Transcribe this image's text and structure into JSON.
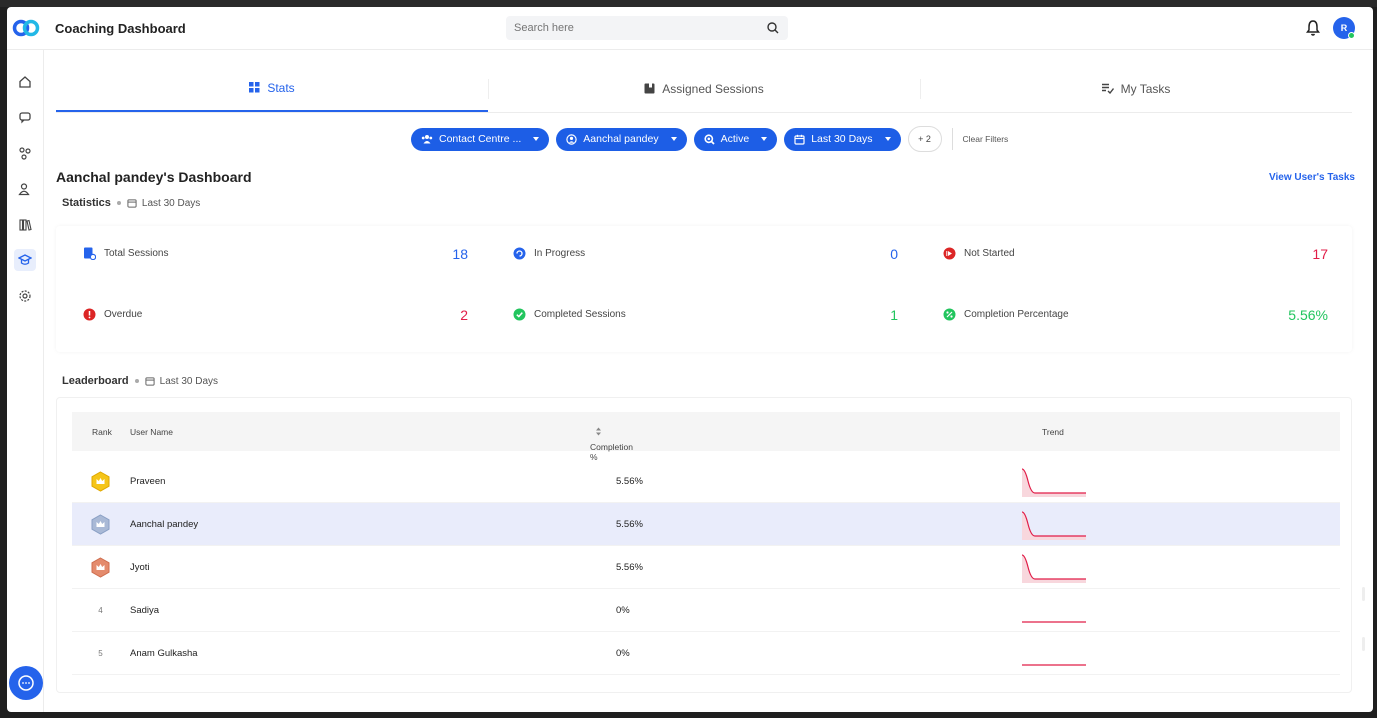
{
  "app": {
    "title": "Coaching Dashboard",
    "avatar_initial": "R"
  },
  "search": {
    "placeholder": "Search here"
  },
  "tabs": [
    {
      "label": "Stats",
      "icon": "grid-icon",
      "active": true
    },
    {
      "label": "Assigned Sessions",
      "icon": "book-icon",
      "active": false
    },
    {
      "label": "My Tasks",
      "icon": "tasks-icon",
      "active": false
    }
  ],
  "filters": {
    "chips": [
      {
        "label": "Contact Centre ...",
        "icon": "team-icon"
      },
      {
        "label": "Aanchal pandey",
        "icon": "user-circle-icon"
      },
      {
        "label": "Active",
        "icon": "search-status-icon"
      },
      {
        "label": "Last 30 Days",
        "icon": "calendar-icon"
      }
    ],
    "more": "+ 2",
    "clear": "Clear Filters"
  },
  "dashboard": {
    "title": "Aanchal pandey's Dashboard",
    "view_tasks": "View User's Tasks"
  },
  "statistics": {
    "label": "Statistics",
    "range": "Last 30 Days",
    "items": [
      {
        "label": "Total Sessions",
        "value": "18",
        "color": "#2563eb",
        "icon": "session-icon"
      },
      {
        "label": "In Progress",
        "value": "0",
        "color": "#2563eb",
        "icon": "progress-icon"
      },
      {
        "label": "Not Started",
        "value": "17",
        "color": "#e11d48",
        "icon": "not-started-icon"
      },
      {
        "label": "Overdue",
        "value": "2",
        "color": "#e11d48",
        "icon": "alert-icon"
      },
      {
        "label": "Completed Sessions",
        "value": "1",
        "color": "#22c55e",
        "icon": "check-icon"
      },
      {
        "label": "Completion Percentage",
        "value": "5.56%",
        "color": "#22c55e",
        "icon": "percent-icon"
      }
    ]
  },
  "leaderboard": {
    "label": "Leaderboard",
    "range": "Last 30 Days",
    "columns": {
      "rank": "Rank",
      "user": "User Name",
      "completion": "Completion %",
      "trend": "Trend"
    },
    "rows": [
      {
        "rank": "1",
        "badge": "gold",
        "name": "Praveen",
        "pct": "5.56%",
        "trend": "spike"
      },
      {
        "rank": "2",
        "badge": "silver",
        "name": "Aanchal pandey",
        "pct": "5.56%",
        "trend": "spike"
      },
      {
        "rank": "3",
        "badge": "bronze",
        "name": "Jyoti",
        "pct": "5.56%",
        "trend": "spike"
      },
      {
        "rank": "4",
        "badge": "",
        "name": "Sadiya",
        "pct": "0%",
        "trend": "flat"
      },
      {
        "rank": "5",
        "badge": "",
        "name": "Anam Gulkasha",
        "pct": "0%",
        "trend": "flat"
      }
    ]
  }
}
